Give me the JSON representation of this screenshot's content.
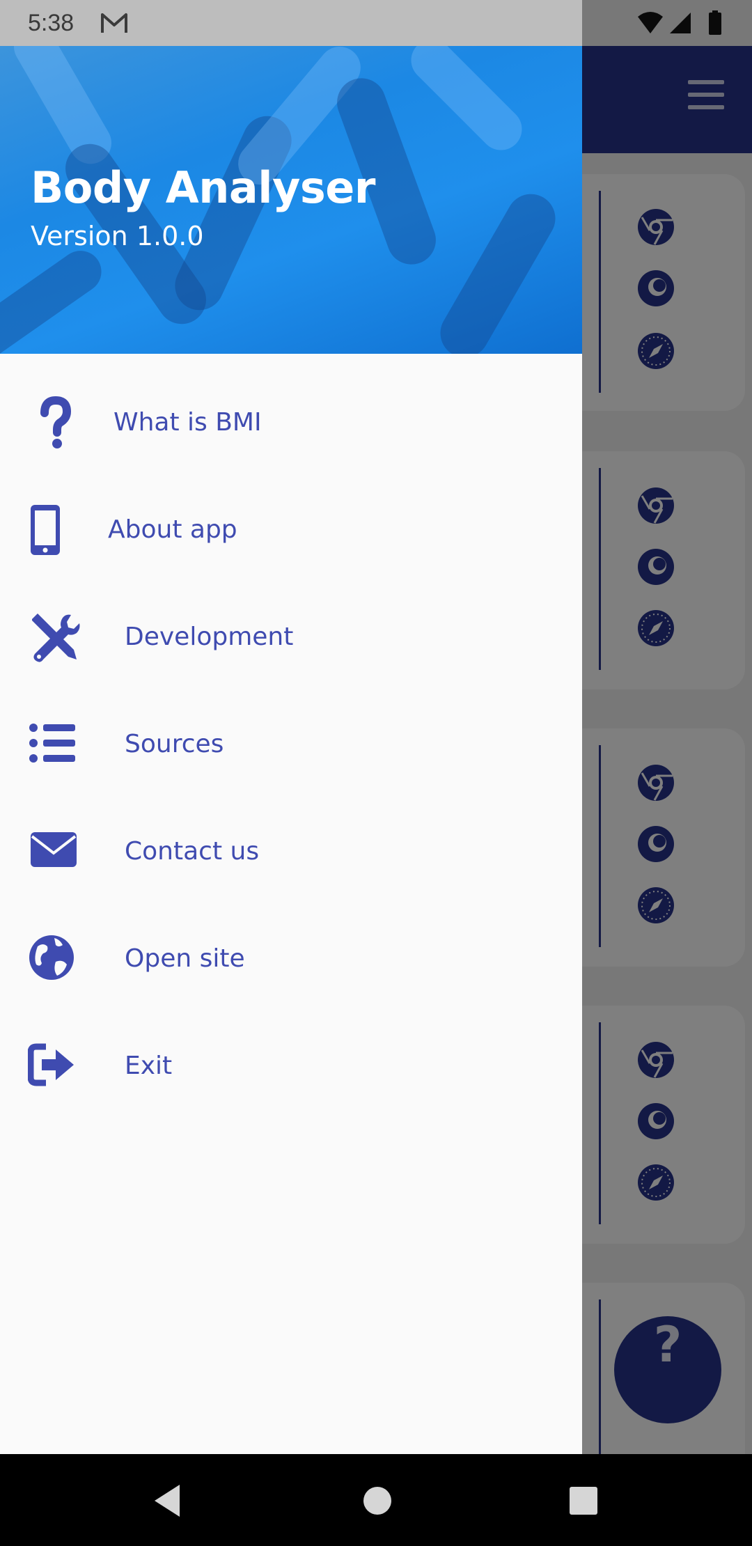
{
  "status_bar": {
    "time": "5:38"
  },
  "drawer": {
    "header": {
      "title": "Body Analyser",
      "version": "Version 1.0.0"
    },
    "items": [
      {
        "label": "What is BMI",
        "icon": "question-icon"
      },
      {
        "label": "About app",
        "icon": "phone-icon"
      },
      {
        "label": "Development",
        "icon": "tools-icon"
      },
      {
        "label": "Sources",
        "icon": "list-icon"
      },
      {
        "label": "Contact us",
        "icon": "envelope-icon"
      },
      {
        "label": "Open site",
        "icon": "globe-icon"
      },
      {
        "label": "Exit",
        "icon": "exit-icon"
      }
    ]
  },
  "background": {
    "fab_label": "?"
  },
  "colors": {
    "toolbar": "#26328a",
    "accent": "#3f4bb0",
    "drawer_bg": "#fafafa",
    "status_bar": "#bdbdbd"
  }
}
